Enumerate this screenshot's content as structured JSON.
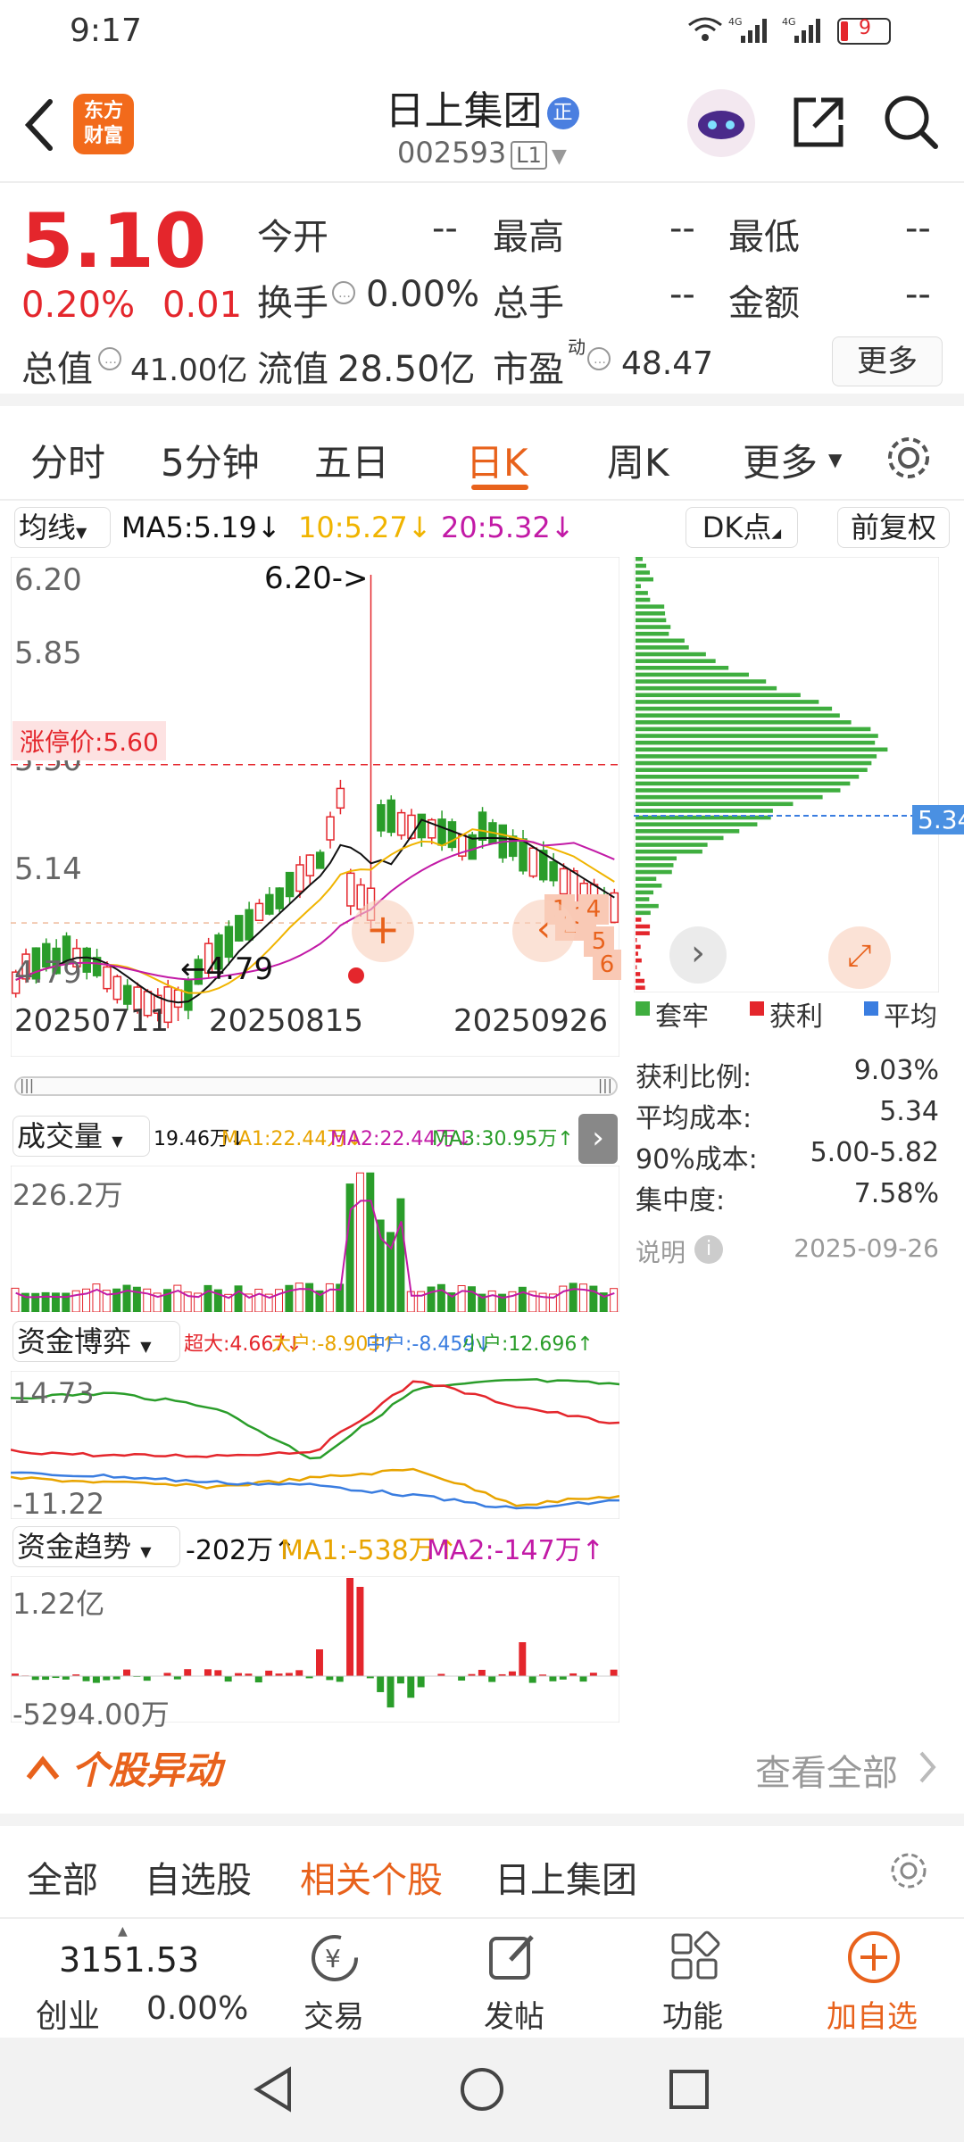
{
  "status": {
    "time": "9:17",
    "network": "4G",
    "battery": "9"
  },
  "header": {
    "title": "日上集团",
    "badge": "正",
    "code": "002593",
    "level": "L1",
    "logo_line1": "东方",
    "logo_line2": "财富"
  },
  "quote": {
    "price": "5.10",
    "change_pct": "0.20%",
    "change": "0.01",
    "open_label": "今开",
    "open": "--",
    "high_label": "最高",
    "high": "--",
    "low_label": "最低",
    "low": "--",
    "turnover_label": "换手",
    "turnover": "0.00%",
    "volume_label": "总手",
    "volume": "--",
    "amount_label": "金额",
    "amount": "--",
    "mktcap_label": "总值",
    "mktcap": "41.00亿",
    "float_label": "流值",
    "float": "28.50亿",
    "pe_label": "市盈",
    "pe_sup": "动",
    "pe": "48.47",
    "more": "更多"
  },
  "tabs": [
    "分时",
    "5分钟",
    "五日",
    "日K",
    "周K",
    "更多"
  ],
  "ma_bar": {
    "selector": "均线",
    "ma5": "MA5:5.19↓",
    "ma10": "10:5.27↓",
    "ma20": "20:5.32↓",
    "dk": "DK点",
    "fq": "前复权"
  },
  "kline": {
    "y_labels": [
      "6.20",
      "5.85",
      "5.50",
      "5.14",
      "4.79"
    ],
    "high_mark": "6.20->",
    "low_mark": "←4.79",
    "limit_label": "涨停价:5.60",
    "dates": [
      "20250711",
      "20250815",
      "20250926"
    ],
    "marks": [
      "1",
      "2",
      "3",
      "4",
      "5",
      "6"
    ],
    "colors": {
      "up": "#e4262c",
      "down": "#2a9d2a",
      "ma5": "#111111",
      "ma10": "#f0b400",
      "ma20": "#c21aa6"
    }
  },
  "chip": {
    "price_tag": "5.34",
    "legend": [
      "套牢",
      "获利",
      "平均"
    ],
    "stats": [
      {
        "k": "获利比例:",
        "v": "9.03%"
      },
      {
        "k": "平均成本:",
        "v": "5.34"
      },
      {
        "k": "90%成本:",
        "v": "5.00-5.82"
      },
      {
        "k": "集中度:",
        "v": "7.58%"
      }
    ],
    "note": "说明",
    "date": "2025-09-26"
  },
  "volume": {
    "selector": "成交量",
    "v": "19.46万↓",
    "ma1": "MA1:22.44万↓",
    "ma2": "MA2:22.44万↓",
    "ma3": "MA3:30.95万↑",
    "top": "226.2万"
  },
  "fund_game": {
    "selector": "资金博弈",
    "c1": "超大:4.667↓",
    "c2": "大户:-8.903↑",
    "c3": "中户:-8.459↓",
    "c4": "小户:12.696↑",
    "top": "14.73",
    "bottom": "-11.22"
  },
  "fund_trend": {
    "selector": "资金趋势",
    "v": "-202万↑",
    "ma1": "MA1:-538万↑",
    "ma2": "MA2:-147万↑",
    "top": "1.22亿",
    "bottom": "-5294.00万"
  },
  "movement": {
    "title": "个股异动",
    "view_all": "查看全部"
  },
  "subtabs": [
    "全部",
    "自选股",
    "相关个股",
    "日上集团"
  ],
  "bottom": {
    "index_value": "3151.53",
    "index_name": "创业",
    "index_pct": "0.00%",
    "trade": "交易",
    "post": "发帖",
    "func": "功能",
    "add": "加自选"
  }
}
